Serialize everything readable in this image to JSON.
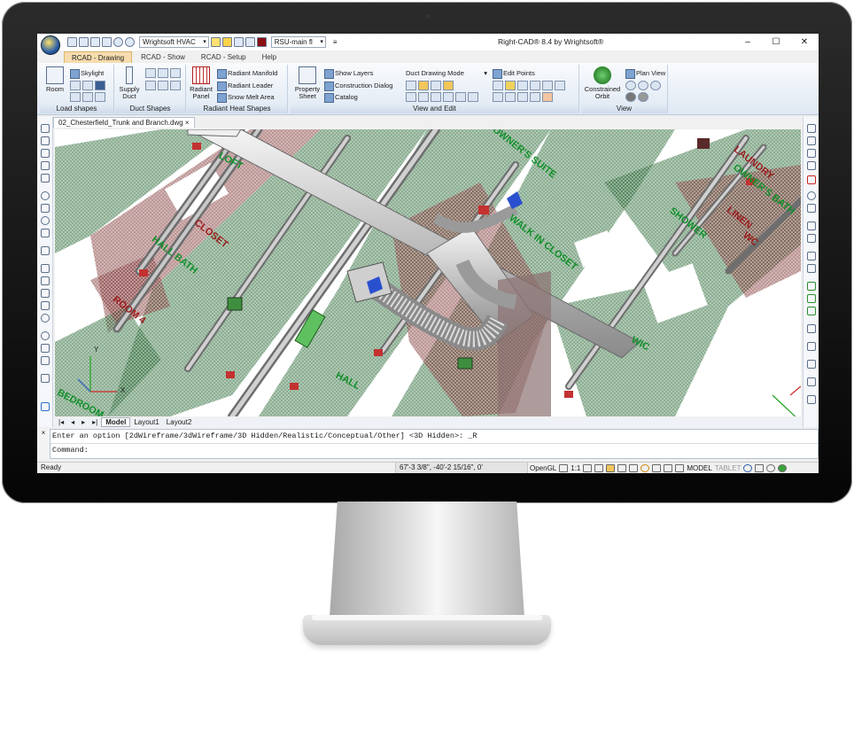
{
  "window": {
    "title": "Right-CAD® 8.4 by Wrightsoft®",
    "qat_combo1": "Wrightsoft HVAC",
    "qat_combo2": "RSU-main fl"
  },
  "ribbon_tabs": [
    "RCAD - Drawing",
    "RCAD - Show",
    "RCAD - Setup",
    "Help"
  ],
  "groups": {
    "load_shapes": {
      "label": "Load shapes",
      "room": "Room",
      "skylight": "Skylight"
    },
    "duct_shapes": {
      "label": "Duct Shapes",
      "supply_duct": "Supply Duct"
    },
    "radiant": {
      "label": "Radiant Heat Shapes",
      "radiant_panel": "Radiant Panel",
      "radiant_manifold": "Radiant Manifold",
      "radiant_leader": "Radiant Leader",
      "snow_melt": "Snow Melt Area"
    },
    "view_edit": {
      "label": "View and Edit",
      "property_sheet": "Property Sheet",
      "show_layers": "Show Layers",
      "construction_dialog": "Construction Dialog",
      "catalog": "Catalog",
      "duct_mode": "Duct Drawing Mode",
      "edit_points": "Edit Points"
    },
    "view": {
      "label": "View",
      "constrained_orbit": "Constrained Orbit",
      "plan_view": "Plan View"
    }
  },
  "document_tab": "02_Chesterfield_Trunk and Branch.dwg",
  "rooms": [
    {
      "text": "LOFT"
    },
    {
      "text": "OWNER'S SUITE"
    },
    {
      "text": "LAUNDRY"
    },
    {
      "text": "OWNER'S BATH"
    },
    {
      "text": "WC"
    },
    {
      "text": "HALL BATH"
    },
    {
      "text": "WALK IN CLOSET"
    },
    {
      "text": "HALL"
    },
    {
      "text": "WIC"
    },
    {
      "text": "BEDROOM"
    },
    {
      "text": "CLOSET"
    },
    {
      "text": "ROOM 4"
    },
    {
      "text": "SHOWER"
    },
    {
      "text": "LINEN"
    }
  ],
  "axes": {
    "x": "X",
    "y": "Y"
  },
  "layout_tabs": [
    "Model",
    "Layout1",
    "Layout2"
  ],
  "command": {
    "prompt": "Enter an option [2dWireframe/3dWireframe/3D Hidden/Realistic/Conceptual/Other] <3D Hidden>: _R",
    "label": "Command:"
  },
  "status": {
    "ready": "Ready",
    "coords": "67'-3 3/8\", -40'-2 15/16\", 0'",
    "opengl": "OpenGL",
    "scale": "1:1",
    "model": "MODEL",
    "tablet": "TABLET"
  },
  "colors": {
    "room_green": "#118f2a",
    "pink": "#c98a8a",
    "ribbon_active": "#f6dcae"
  }
}
